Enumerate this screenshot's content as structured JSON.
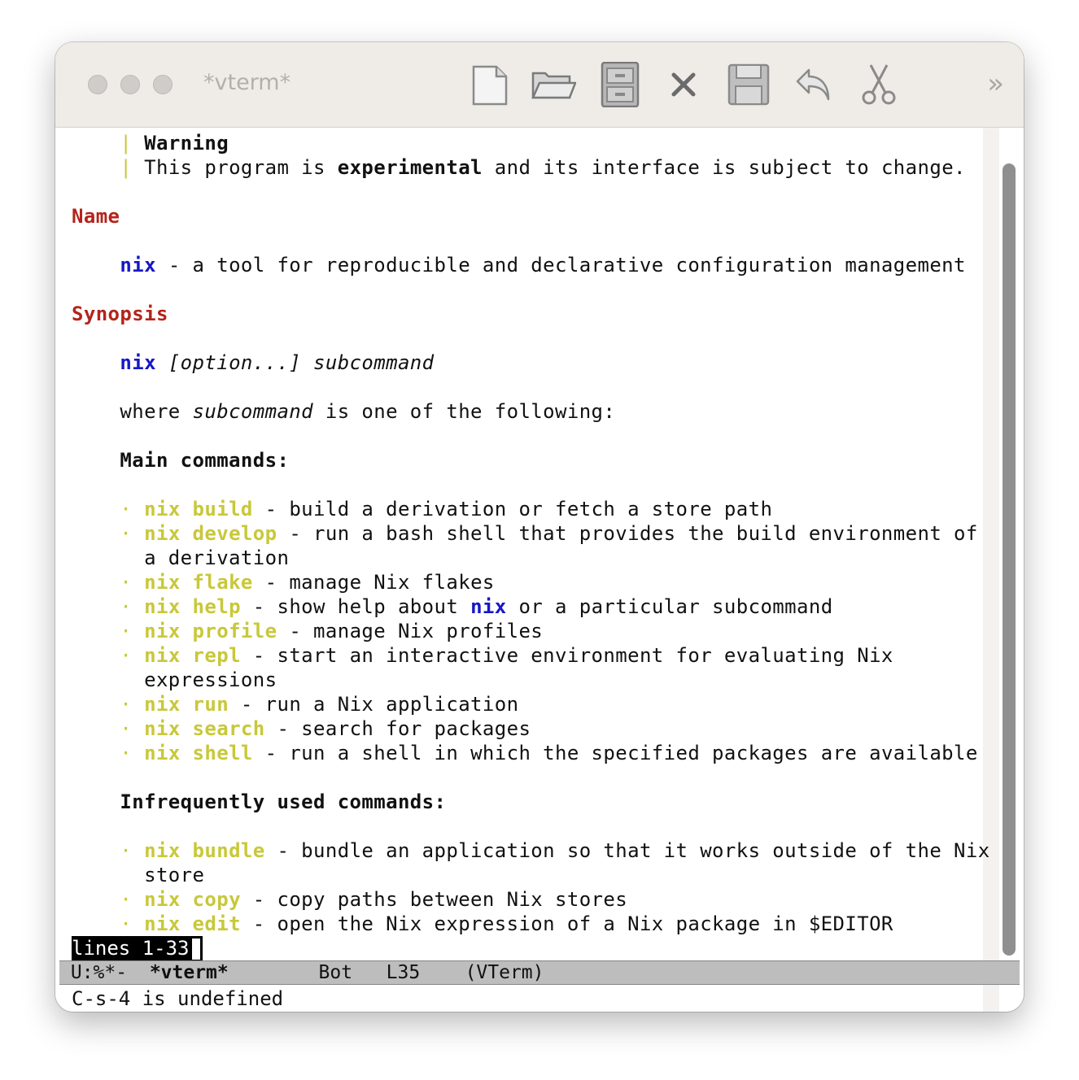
{
  "window": {
    "title": "*vterm*"
  },
  "toolbar": {
    "buttons": [
      {
        "name": "new-file",
        "icon": "new-file-icon"
      },
      {
        "name": "open-file",
        "icon": "open-folder-icon"
      },
      {
        "name": "dired",
        "icon": "file-cabinet-icon"
      },
      {
        "name": "kill-buffer",
        "icon": "close-icon"
      },
      {
        "name": "save",
        "icon": "floppy-disk-icon"
      },
      {
        "name": "undo",
        "icon": "undo-icon"
      },
      {
        "name": "cut",
        "icon": "scissors-icon"
      }
    ],
    "overflow": "»"
  },
  "doc": {
    "warning_bar": "|",
    "warning_title": "Warning",
    "warning_p1": "This program is ",
    "warning_bold": "experimental",
    "warning_p2": " and its interface is subject to change.",
    "name_heading": "Name",
    "name_cmd": "nix",
    "name_desc": " - a tool for reproducible and declarative configuration management",
    "synopsis_heading": "Synopsis",
    "syn_cmd": "nix",
    "syn_opt": " [option...] ",
    "syn_sub": "subcommand",
    "where_a": "where ",
    "where_sub": "subcommand",
    "where_b": " is one of the following:",
    "main_heading": "Main commands:",
    "bullet": "·",
    "main": [
      {
        "cmd": "nix build",
        "desc": " - build a derivation or fetch a store path"
      },
      {
        "cmd": "nix develop",
        "desc": " - run a bash shell that provides the build environment of",
        "cont": "a derivation"
      },
      {
        "cmd": "nix flake",
        "desc": " - manage Nix flakes"
      },
      {
        "cmd": "nix help",
        "desc_a": " - show help about ",
        "desc_k": "nix",
        "desc_b": " or a particular subcommand"
      },
      {
        "cmd": "nix profile",
        "desc": " - manage Nix profiles"
      },
      {
        "cmd": "nix repl",
        "desc": " - start an interactive environment for evaluating Nix",
        "cont": "expressions"
      },
      {
        "cmd": "nix run",
        "desc": " - run a Nix application"
      },
      {
        "cmd": "nix search",
        "desc": " - search for packages"
      },
      {
        "cmd": "nix shell",
        "desc": " - run a shell in which the specified packages are available"
      }
    ],
    "infreq_heading": "Infrequently used commands:",
    "infreq": [
      {
        "cmd": "nix bundle",
        "desc": " - bundle an application so that it works outside of the Nix",
        "cont": "store"
      },
      {
        "cmd": "nix copy",
        "desc": " - copy paths between Nix stores"
      },
      {
        "cmd": "nix edit",
        "desc": " - open the Nix expression of a Nix package in $EDITOR"
      }
    ]
  },
  "pager_status": "lines 1-33",
  "modeline": {
    "state": "U:%*-",
    "buffer": "*vterm*",
    "position": "Bot",
    "line": "L35",
    "mode": "(VTerm)"
  },
  "echo_area": "C-s-4 is undefined"
}
